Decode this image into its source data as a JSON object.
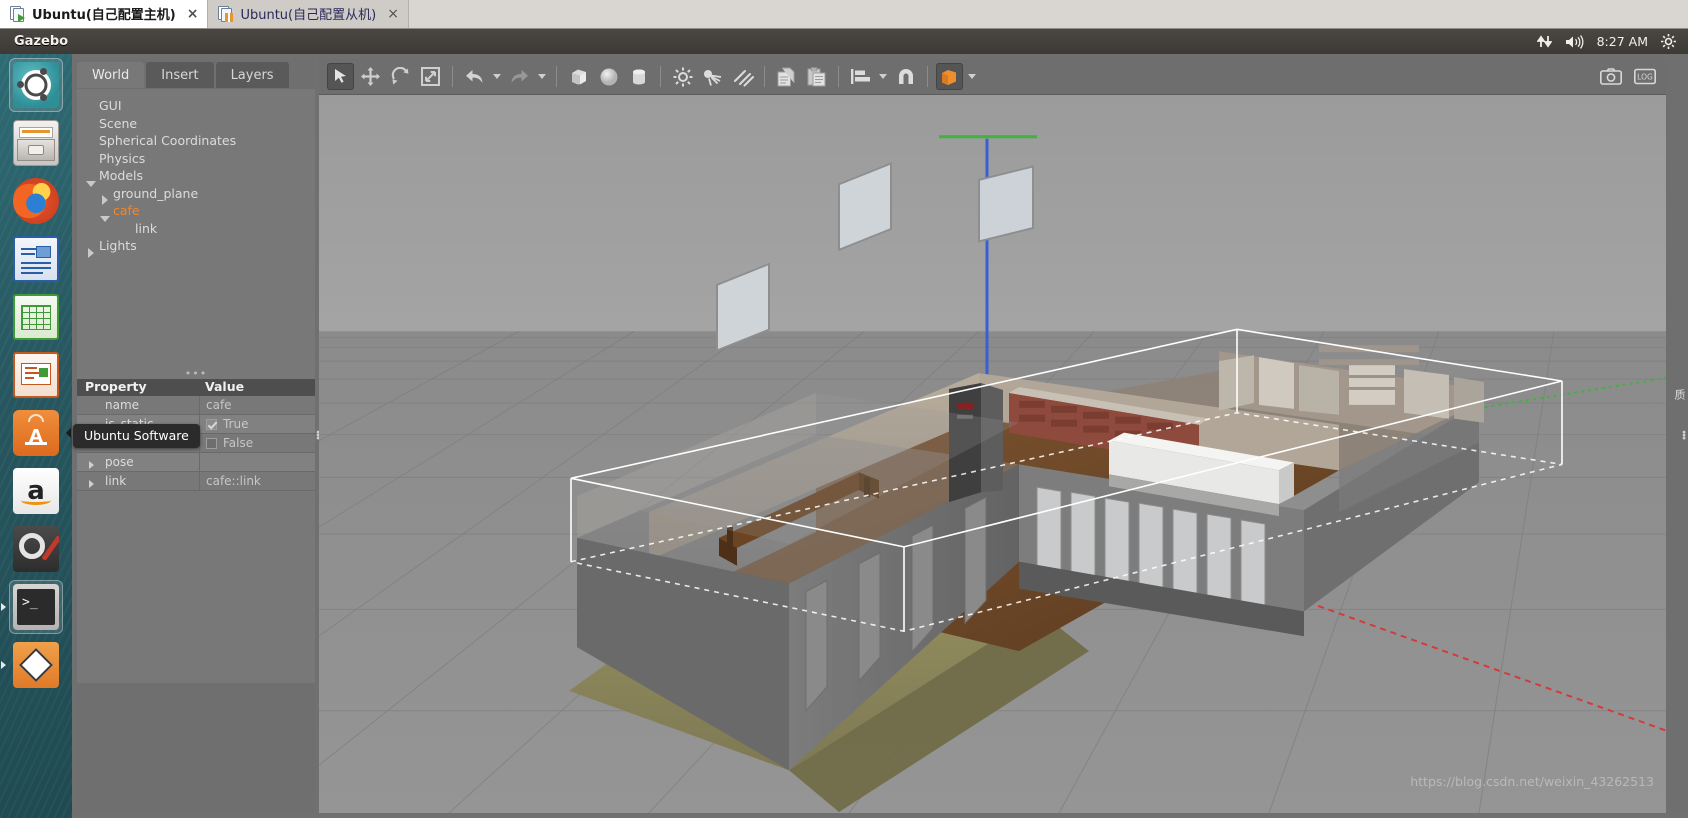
{
  "vm_tabs": [
    {
      "label": "Ubuntu(自己配置主机)",
      "state": "running",
      "active": true,
      "close": "×",
      "icon": "vm-screen-icon"
    },
    {
      "label": "Ubuntu(自己配置从机)",
      "state": "paused",
      "active": false,
      "close": "×",
      "icon": "vm-screen-icon"
    }
  ],
  "panel": {
    "app_title": "Gazebo",
    "clock": "8:27 AM",
    "tray_icons": [
      "network-updown-icon",
      "volume-icon",
      "gear-icon"
    ]
  },
  "launcher": {
    "items": [
      {
        "name": "ubuntu-dash",
        "label": "Ubuntu Dash"
      },
      {
        "name": "files",
        "label": "Files"
      },
      {
        "name": "firefox",
        "label": "Firefox"
      },
      {
        "name": "libreoffice-writer",
        "label": "LibreOffice Writer"
      },
      {
        "name": "libreoffice-calc",
        "label": "LibreOffice Calc"
      },
      {
        "name": "libreoffice-impress",
        "label": "LibreOffice Impress"
      },
      {
        "name": "ubuntu-software",
        "label": "Ubuntu Software"
      },
      {
        "name": "amazon",
        "label": "Amazon"
      },
      {
        "name": "system-settings",
        "label": "System Settings"
      },
      {
        "name": "terminal",
        "label": "Terminal"
      },
      {
        "name": "gazebo",
        "label": "Gazebo"
      }
    ]
  },
  "left_dock": {
    "tabs": [
      {
        "label": "World",
        "active": true
      },
      {
        "label": "Insert",
        "active": false
      },
      {
        "label": "Layers",
        "active": false
      }
    ],
    "tree": [
      {
        "label": "GUI",
        "level": 1,
        "twisty": "none",
        "selected": false
      },
      {
        "label": "Scene",
        "level": 1,
        "twisty": "none",
        "selected": false
      },
      {
        "label": "Spherical Coordinates",
        "level": 1,
        "twisty": "none",
        "selected": false
      },
      {
        "label": "Physics",
        "level": 1,
        "twisty": "none",
        "selected": false
      },
      {
        "label": "Models",
        "level": 1,
        "twisty": "down",
        "selected": false
      },
      {
        "label": "ground_plane",
        "level": 2,
        "twisty": "right",
        "selected": false
      },
      {
        "label": "cafe",
        "level": 2,
        "twisty": "down",
        "selected": true
      },
      {
        "label": "link",
        "level": 3,
        "twisty": "none",
        "selected": false
      },
      {
        "label": "Lights",
        "level": 1,
        "twisty": "right",
        "selected": false
      }
    ],
    "property_table": {
      "headers": {
        "property": "Property",
        "value": "Value"
      },
      "rows": [
        {
          "property": "name",
          "value": "cafe",
          "kind": "text",
          "expandable": false
        },
        {
          "property": "is_static",
          "value": "True",
          "kind": "checkbox",
          "checked": true,
          "expandable": false
        },
        {
          "property": "",
          "value": "False",
          "kind": "checkbox",
          "checked": false,
          "expandable": false
        },
        {
          "property": "pose",
          "value": "",
          "kind": "text",
          "expandable": true
        },
        {
          "property": "link",
          "value": "cafe::link",
          "kind": "text",
          "expandable": true
        }
      ]
    },
    "tooltip": "Ubuntu Software"
  },
  "toolbar": {
    "groups": [
      {
        "buttons": [
          {
            "name": "select-mode-button",
            "icon": "cursor-arrow-icon",
            "active": true,
            "disabled": false
          },
          {
            "name": "translate-mode-button",
            "icon": "move-arrows-icon",
            "active": false,
            "disabled": false
          },
          {
            "name": "rotate-mode-button",
            "icon": "rotate-icon",
            "active": false,
            "disabled": false
          },
          {
            "name": "scale-mode-button",
            "icon": "scale-icon",
            "active": false,
            "disabled": false
          }
        ]
      },
      {
        "buttons": [
          {
            "name": "undo-button",
            "icon": "undo-arrow-icon",
            "active": false,
            "disabled": false,
            "caret": true
          },
          {
            "name": "redo-button",
            "icon": "redo-arrow-icon",
            "active": false,
            "disabled": true,
            "caret": true
          }
        ]
      },
      {
        "buttons": [
          {
            "name": "insert-box-button",
            "icon": "box-icon",
            "active": false,
            "disabled": false
          },
          {
            "name": "insert-sphere-button",
            "icon": "sphere-icon",
            "active": false,
            "disabled": false
          },
          {
            "name": "insert-cylinder-button",
            "icon": "cylinder-icon",
            "active": false,
            "disabled": false
          }
        ]
      },
      {
        "buttons": [
          {
            "name": "point-light-button",
            "icon": "point-light-icon",
            "active": false,
            "disabled": false
          },
          {
            "name": "spot-light-button",
            "icon": "spot-light-icon",
            "active": false,
            "disabled": false
          },
          {
            "name": "directional-light-button",
            "icon": "directional-light-icon",
            "active": false,
            "disabled": false
          }
        ]
      },
      {
        "buttons": [
          {
            "name": "copy-button",
            "icon": "copy-icon",
            "active": false,
            "disabled": false
          },
          {
            "name": "paste-button",
            "icon": "paste-icon",
            "active": false,
            "disabled": false
          }
        ]
      },
      {
        "buttons": [
          {
            "name": "align-button",
            "icon": "align-icon",
            "active": false,
            "disabled": false,
            "caret": true
          },
          {
            "name": "snap-button",
            "icon": "magnet-snap-icon",
            "active": false,
            "disabled": false
          }
        ]
      },
      {
        "buttons": [
          {
            "name": "view-angle-button",
            "icon": "view-cube-icon",
            "active": true,
            "disabled": false,
            "caret": true
          }
        ]
      }
    ],
    "right_buttons": [
      {
        "name": "screenshot-button",
        "icon": "camera-icon"
      },
      {
        "name": "log-record-button",
        "icon": "record-log-icon"
      }
    ]
  },
  "viewport": {
    "selected_model": "cafe",
    "axis_colors": {
      "x": "#d43a3a",
      "y": "#3fb23f",
      "z": "#3a5fd4"
    },
    "selection_box": true,
    "description": "Gazebo cafe world — cafe building model selected with white bounding box, ground plane grid"
  },
  "right_strip": {
    "label": "质"
  },
  "watermark": "https://blog.csdn.net/weixin_43262513"
}
